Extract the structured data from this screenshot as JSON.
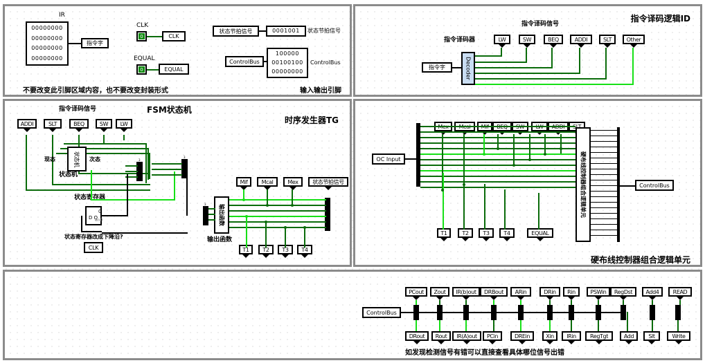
{
  "app": {
    "background": "#ffffff",
    "wire_dark": "#0a6b0a",
    "wire_light": "#16e016",
    "panel_border": "#8b8b8b"
  },
  "panel_io": {
    "title": "",
    "ir_label": "IR",
    "ir_rows": [
      "00000000",
      "00000000",
      "00000000",
      "00000000"
    ],
    "ir_terminal": "指令字",
    "clk_label": "CLK",
    "clk_value": "0",
    "clk_terminal": "CLK",
    "equal_label": "EQUAL",
    "equal_value": "0",
    "equal_terminal": "EQUAL",
    "status_source": "状态节拍信号",
    "status_bits": "0001001",
    "status_indicator": "状态节拍信号",
    "controlbus_source": "ControlBus",
    "controlbus_rows": [
      "100000",
      "00100100",
      "00000000"
    ],
    "controlbus_indicator": "ControlBus",
    "note_left": "不要改变此引脚区域内容，也不要改变封装形式",
    "note_right": "输入输出引脚"
  },
  "panel_id": {
    "title": "指令译码逻辑ID",
    "decoder_label": "指令译码器",
    "decoder_block": "Decoder",
    "input_terminal": "指令字",
    "signals_label": "指令译码信号",
    "outputs": [
      "LW",
      "SW",
      "BEQ",
      "ADDI",
      "SLT",
      "Other"
    ]
  },
  "panel_tg": {
    "title": "时序发生器TG",
    "fsm_title": "FSM状态机",
    "decode_signals_label": "指令译码信号",
    "inputs": [
      "ADDI",
      "SLT",
      "BEQ",
      "SW",
      "LW"
    ],
    "fsm_box": "状态机",
    "present_state": "现态",
    "next_state": "次态",
    "state_reg_label": "状态寄存器",
    "dff_d": "D",
    "dff_q": "Q",
    "dff_top": "0",
    "dff_en": "en0",
    "reg_note": "状态寄存器改成下降沿?",
    "clk_terminal": "CLK",
    "outfunc_box": "输出函数",
    "outfunc_label": "输出函数",
    "mode_outputs": [
      "Mif",
      "Mcal",
      "Mex"
    ],
    "status_indicator": "状态节拍信号",
    "timing_outputs": [
      "T1",
      "T2",
      "T3",
      "T4"
    ]
  },
  "panel_hw": {
    "title": "硬布线控制器组合逻辑单元",
    "input_terminal": "OC Input",
    "output_terminal": "ControlBus",
    "logic_block": "硬布线控制器组合逻辑单元",
    "top_inputs": [
      "Mex",
      "Mcal",
      "Mif",
      "BEQ",
      "SW",
      "LW",
      "ADDI",
      "SLT"
    ],
    "bottom_inputs": [
      "T1",
      "T2",
      "T3",
      "T4",
      "EQUAL"
    ],
    "left_pin_count": 13,
    "right_pin_count": 21
  },
  "panel_bottom": {
    "source_terminal": "ControlBus",
    "top_signals": [
      "PCout",
      "Zout",
      "IR(b)out",
      "DRBout",
      "ARin",
      "DRin",
      "Rin",
      "PSWin",
      "RegDst",
      "Add4",
      "READ"
    ],
    "bottom_signals": [
      "DRout",
      "Rout",
      "IR(A)out",
      "PCin",
      "DREin",
      "Xin",
      "IRin",
      "RegTgt",
      "Add",
      "Slt",
      "Write"
    ],
    "caption": "如发现检测信号有错可以直接查看具体哪位信号出错"
  }
}
